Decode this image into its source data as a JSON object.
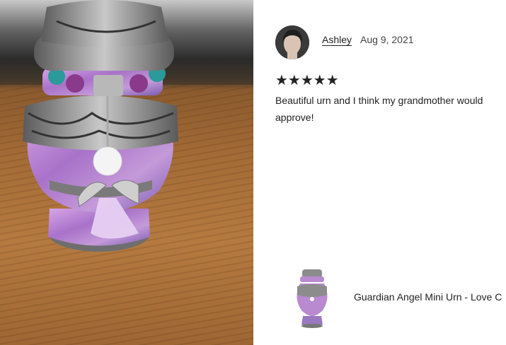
{
  "review": {
    "reviewer_name": "Ashley",
    "date": "Aug 9, 2021",
    "rating": 5,
    "stars_text": "★★★★★",
    "text": "Beautiful urn and I think my grandmother would approve!"
  },
  "product": {
    "title": "Guardian Angel Mini Urn - Love C"
  },
  "icons": {
    "avatar": "reviewer-avatar",
    "photo": "urn-photo",
    "thumbnail": "product-thumbnail"
  },
  "colors": {
    "text": "#222222",
    "urn_lilac": "#b98ad0",
    "urn_pewter": "#8c8c8c",
    "wood": "#a36b36"
  }
}
